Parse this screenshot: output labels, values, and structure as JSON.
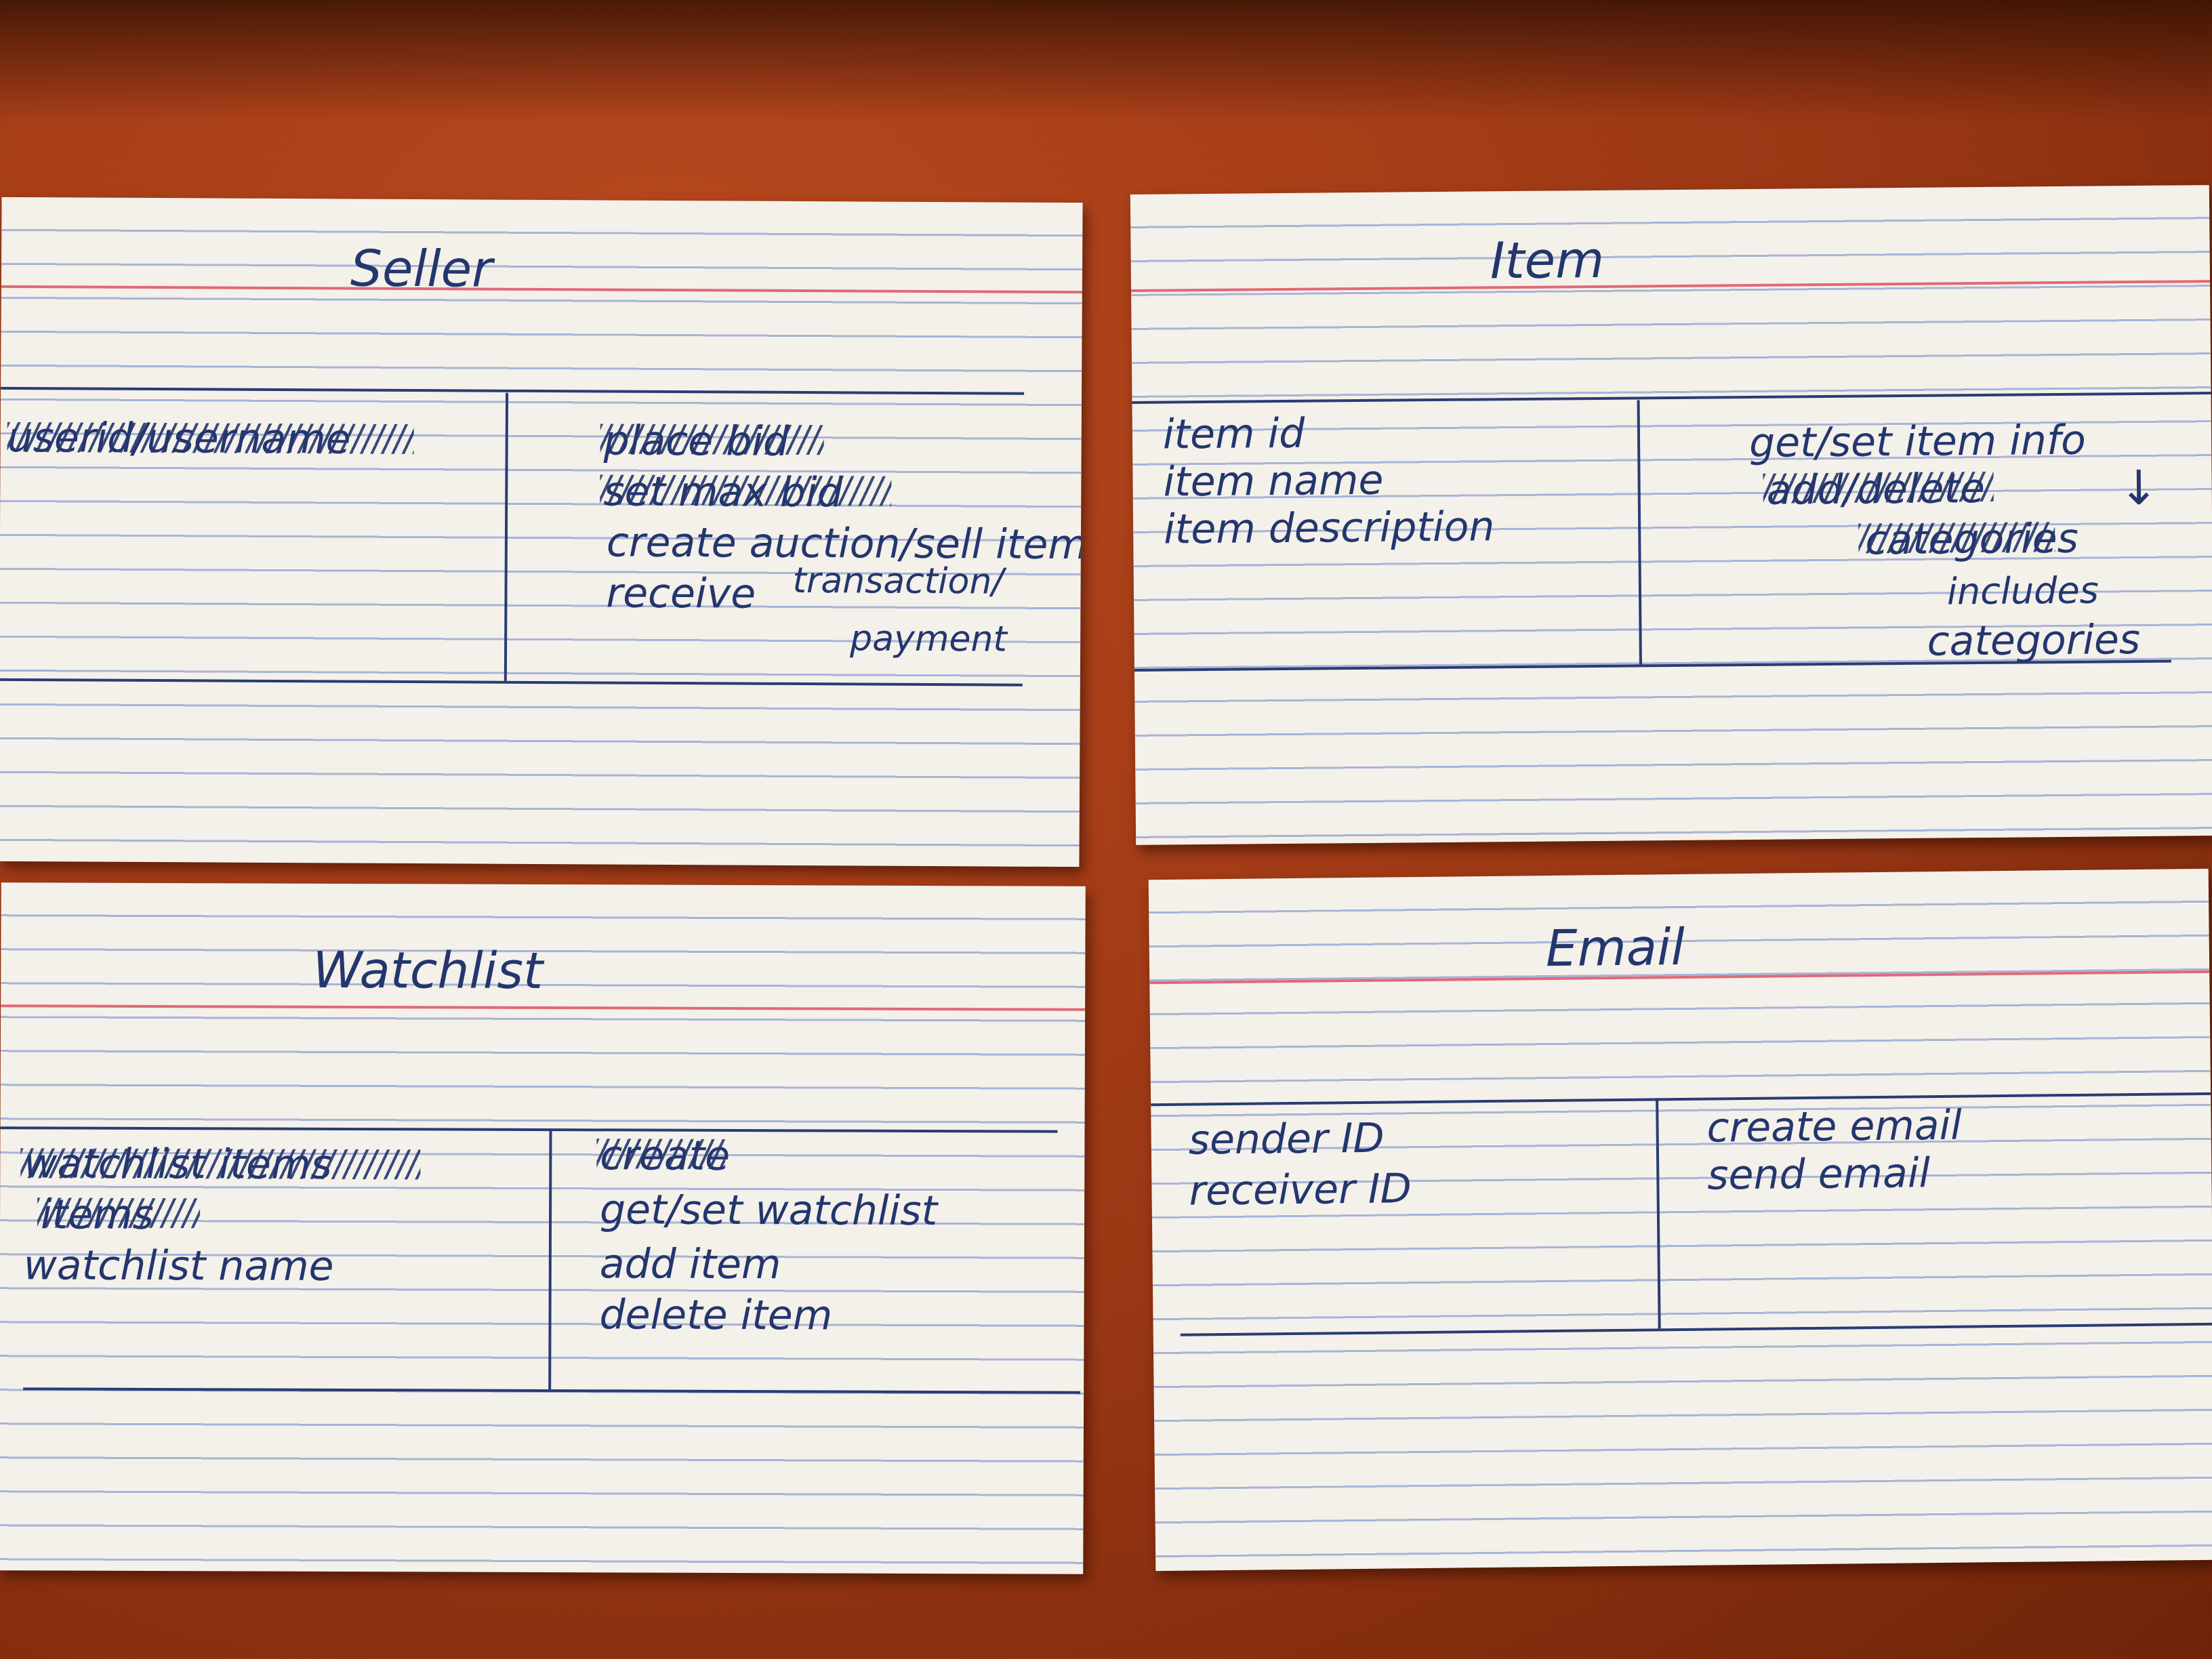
{
  "cards": {
    "seller": {
      "title": "Seller",
      "struck_left": "userid/username",
      "struck_right_1": "place bid",
      "struck_right_2": "set max bid",
      "resp_1": "create auction/sell item",
      "resp_2a": "receive",
      "resp_2b": "transaction/",
      "resp_2c": "payment"
    },
    "item": {
      "title": "Item",
      "attr_1": "item id",
      "attr_2": "item name",
      "attr_3": "item description",
      "resp_1": "get/set item info",
      "struck_1": "add/delete",
      "struck_2": "categories",
      "arrow": "↓",
      "resp_2": "includes",
      "resp_3": "categories"
    },
    "watchlist": {
      "title": "Watchlist",
      "struck_left_1": "watchlist items",
      "struck_left_2": "items",
      "attr_1": "watchlist name",
      "struck_right": "create",
      "resp_1": "get/set watchlist",
      "resp_2": "add item",
      "resp_3": "delete item"
    },
    "email": {
      "title": "Email",
      "attr_1": "sender ID",
      "attr_2": "receiver ID",
      "resp_1": "create email",
      "resp_2": "send email"
    }
  }
}
